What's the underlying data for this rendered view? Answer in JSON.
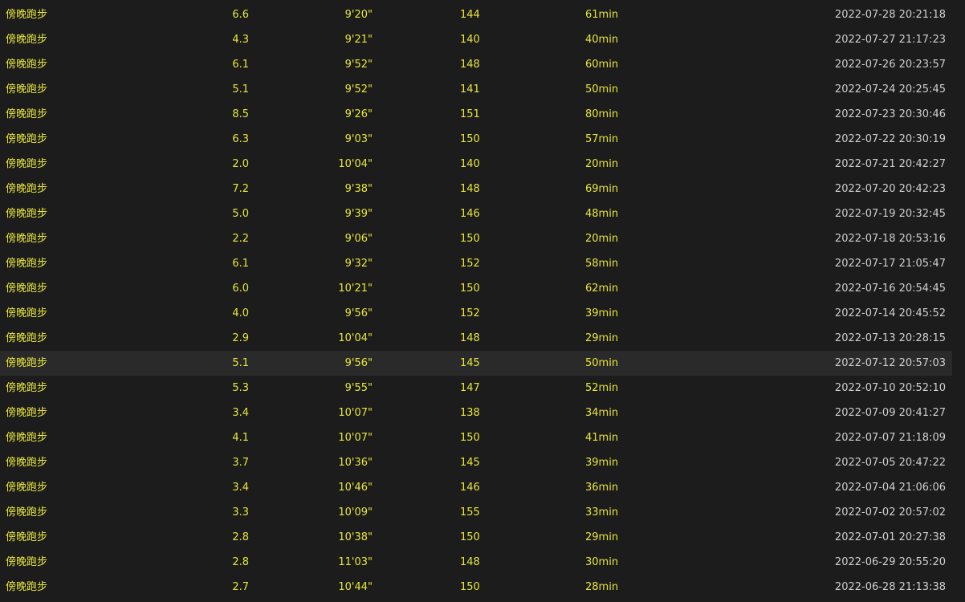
{
  "table": {
    "hover_row": 14,
    "rows": [
      {
        "type": "傍晚跑步",
        "distance": "6.6",
        "pace": "9'20\"",
        "heart_rate": "144",
        "duration": "61min",
        "datetime": "2022-07-28 20:21:18"
      },
      {
        "type": "傍晚跑步",
        "distance": "4.3",
        "pace": "9'21\"",
        "heart_rate": "140",
        "duration": "40min",
        "datetime": "2022-07-27 21:17:23"
      },
      {
        "type": "傍晚跑步",
        "distance": "6.1",
        "pace": "9'52\"",
        "heart_rate": "148",
        "duration": "60min",
        "datetime": "2022-07-26 20:23:57"
      },
      {
        "type": "傍晚跑步",
        "distance": "5.1",
        "pace": "9'52\"",
        "heart_rate": "141",
        "duration": "50min",
        "datetime": "2022-07-24 20:25:45"
      },
      {
        "type": "傍晚跑步",
        "distance": "8.5",
        "pace": "9'26\"",
        "heart_rate": "151",
        "duration": "80min",
        "datetime": "2022-07-23 20:30:46"
      },
      {
        "type": "傍晚跑步",
        "distance": "6.3",
        "pace": "9'03\"",
        "heart_rate": "150",
        "duration": "57min",
        "datetime": "2022-07-22 20:30:19"
      },
      {
        "type": "傍晚跑步",
        "distance": "2.0",
        "pace": "10'04\"",
        "heart_rate": "140",
        "duration": "20min",
        "datetime": "2022-07-21 20:42:27"
      },
      {
        "type": "傍晚跑步",
        "distance": "7.2",
        "pace": "9'38\"",
        "heart_rate": "148",
        "duration": "69min",
        "datetime": "2022-07-20 20:42:23"
      },
      {
        "type": "傍晚跑步",
        "distance": "5.0",
        "pace": "9'39\"",
        "heart_rate": "146",
        "duration": "48min",
        "datetime": "2022-07-19 20:32:45"
      },
      {
        "type": "傍晚跑步",
        "distance": "2.2",
        "pace": "9'06\"",
        "heart_rate": "150",
        "duration": "20min",
        "datetime": "2022-07-18 20:53:16"
      },
      {
        "type": "傍晚跑步",
        "distance": "6.1",
        "pace": "9'32\"",
        "heart_rate": "152",
        "duration": "58min",
        "datetime": "2022-07-17 21:05:47"
      },
      {
        "type": "傍晚跑步",
        "distance": "6.0",
        "pace": "10'21\"",
        "heart_rate": "150",
        "duration": "62min",
        "datetime": "2022-07-16 20:54:45"
      },
      {
        "type": "傍晚跑步",
        "distance": "4.0",
        "pace": "9'56\"",
        "heart_rate": "152",
        "duration": "39min",
        "datetime": "2022-07-14 20:45:52"
      },
      {
        "type": "傍晚跑步",
        "distance": "2.9",
        "pace": "10'04\"",
        "heart_rate": "148",
        "duration": "29min",
        "datetime": "2022-07-13 20:28:15"
      },
      {
        "type": "傍晚跑步",
        "distance": "5.1",
        "pace": "9'56\"",
        "heart_rate": "145",
        "duration": "50min",
        "datetime": "2022-07-12 20:57:03"
      },
      {
        "type": "傍晚跑步",
        "distance": "5.3",
        "pace": "9'55\"",
        "heart_rate": "147",
        "duration": "52min",
        "datetime": "2022-07-10 20:52:10"
      },
      {
        "type": "傍晚跑步",
        "distance": "3.4",
        "pace": "10'07\"",
        "heart_rate": "138",
        "duration": "34min",
        "datetime": "2022-07-09 20:41:27"
      },
      {
        "type": "傍晚跑步",
        "distance": "4.1",
        "pace": "10'07\"",
        "heart_rate": "150",
        "duration": "41min",
        "datetime": "2022-07-07 21:18:09"
      },
      {
        "type": "傍晚跑步",
        "distance": "3.7",
        "pace": "10'36\"",
        "heart_rate": "145",
        "duration": "39min",
        "datetime": "2022-07-05 20:47:22"
      },
      {
        "type": "傍晚跑步",
        "distance": "3.4",
        "pace": "10'46\"",
        "heart_rate": "146",
        "duration": "36min",
        "datetime": "2022-07-04 21:06:06"
      },
      {
        "type": "傍晚跑步",
        "distance": "3.3",
        "pace": "10'09\"",
        "heart_rate": "155",
        "duration": "33min",
        "datetime": "2022-07-02 20:57:02"
      },
      {
        "type": "傍晚跑步",
        "distance": "2.8",
        "pace": "10'38\"",
        "heart_rate": "150",
        "duration": "29min",
        "datetime": "2022-07-01 20:27:38"
      },
      {
        "type": "傍晚跑步",
        "distance": "2.8",
        "pace": "11'03\"",
        "heart_rate": "148",
        "duration": "30min",
        "datetime": "2022-06-29 20:55:20"
      },
      {
        "type": "傍晚跑步",
        "distance": "2.7",
        "pace": "10'44\"",
        "heart_rate": "150",
        "duration": "28min",
        "datetime": "2022-06-28 21:13:38"
      }
    ]
  },
  "colors": {
    "background": "#1c1c1c",
    "hover_row": "#2a2a2a",
    "value_text": "#e8e63a",
    "date_text": "#cfcfcf"
  }
}
